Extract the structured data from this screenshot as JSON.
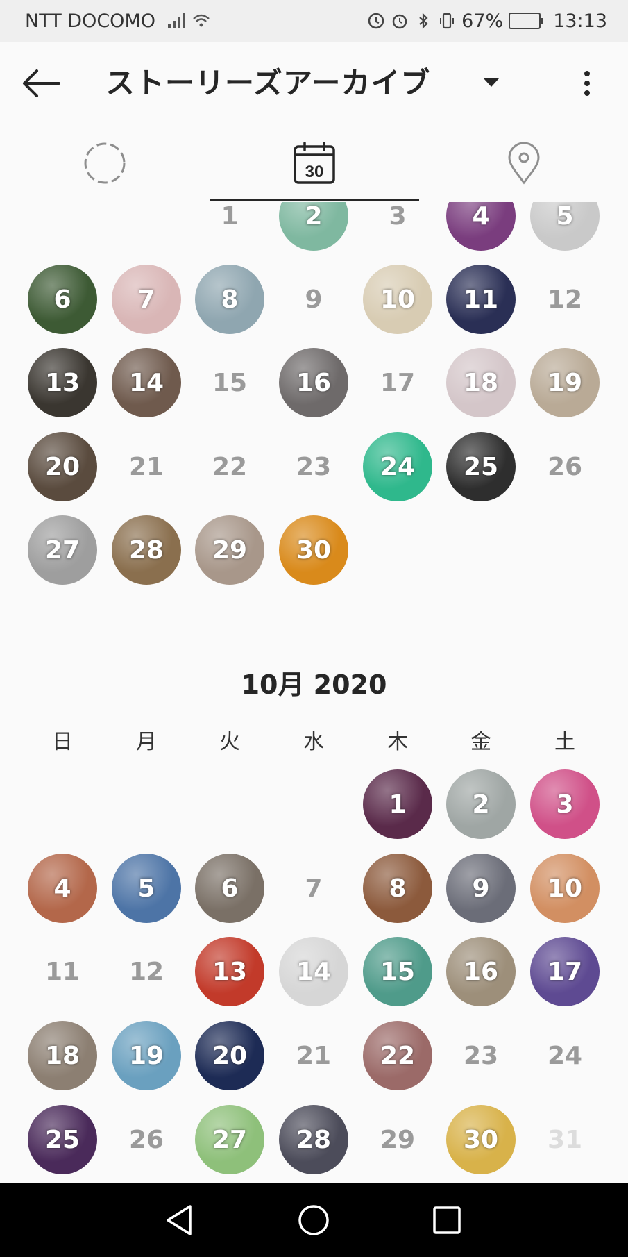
{
  "status_bar": {
    "carrier": "NTT DOCOMO",
    "battery": "67%",
    "battery_level": 0.67,
    "time": "13:13"
  },
  "header": {
    "title": "ストーリーズアーカイブ"
  },
  "tabs": [
    {
      "id": "stories",
      "icon": "dashed-circle-icon",
      "selected": false
    },
    {
      "id": "calendar",
      "icon": "calendar-icon",
      "label": "30",
      "selected": true
    },
    {
      "id": "map",
      "icon": "location-pin-icon",
      "selected": false
    }
  ],
  "weekdays": [
    "日",
    "月",
    "火",
    "水",
    "木",
    "金",
    "土"
  ],
  "september": {
    "first_weekday": 2,
    "days": [
      {
        "d": "1",
        "color": null
      },
      {
        "d": "2",
        "color": "#7fb8a0"
      },
      {
        "d": "3",
        "color": null
      },
      {
        "d": "4",
        "color": "#7a3d7e"
      },
      {
        "d": "5",
        "color": "#c9c9c9"
      },
      {
        "d": "6",
        "color": "#3d5a34"
      },
      {
        "d": "7",
        "color": "#d9b6b6"
      },
      {
        "d": "8",
        "color": "#8fa6b0"
      },
      {
        "d": "9",
        "color": null
      },
      {
        "d": "10",
        "color": "#d8ccb3"
      },
      {
        "d": "11",
        "color": "#2a2f55"
      },
      {
        "d": "12",
        "color": null
      },
      {
        "d": "13",
        "color": "#3a3630"
      },
      {
        "d": "14",
        "color": "#6f5a4d"
      },
      {
        "d": "15",
        "color": null
      },
      {
        "d": "16",
        "color": "#6e6a6a"
      },
      {
        "d": "17",
        "color": null
      },
      {
        "d": "18",
        "color": "#d4c6c9"
      },
      {
        "d": "19",
        "color": "#b9aa96"
      },
      {
        "d": "20",
        "color": "#5a4b3e"
      },
      {
        "d": "21",
        "color": null
      },
      {
        "d": "22",
        "color": null
      },
      {
        "d": "23",
        "color": null
      },
      {
        "d": "24",
        "color": "#2fb88c"
      },
      {
        "d": "25",
        "color": "#2e2e2e"
      },
      {
        "d": "26",
        "color": null
      },
      {
        "d": "27",
        "color": "#9e9e9e"
      },
      {
        "d": "28",
        "color": "#8a6f4e"
      },
      {
        "d": "29",
        "color": "#a8978a"
      },
      {
        "d": "30",
        "color": "#d98a1b"
      }
    ]
  },
  "october": {
    "title": "10月 2020",
    "first_weekday": 4,
    "days": [
      {
        "d": "1",
        "color": "#5a2a4a"
      },
      {
        "d": "2",
        "color": "#9fa6a4"
      },
      {
        "d": "3",
        "color": "#d05088"
      },
      {
        "d": "4",
        "color": "#b3674a"
      },
      {
        "d": "5",
        "color": "#4d74a6"
      },
      {
        "d": "6",
        "color": "#7a7066"
      },
      {
        "d": "7",
        "color": null
      },
      {
        "d": "8",
        "color": "#8c5a3c"
      },
      {
        "d": "9",
        "color": "#6b6d78"
      },
      {
        "d": "10",
        "color": "#d28f62"
      },
      {
        "d": "11",
        "color": null
      },
      {
        "d": "12",
        "color": null
      },
      {
        "d": "13",
        "color": "#c23a2a"
      },
      {
        "d": "14",
        "color": "#d6d6d6"
      },
      {
        "d": "15",
        "color": "#4f9b8a"
      },
      {
        "d": "16",
        "color": "#9d8f7a"
      },
      {
        "d": "17",
        "color": "#5e4a92"
      },
      {
        "d": "18",
        "color": "#8c7f72"
      },
      {
        "d": "19",
        "color": "#6aa0bf"
      },
      {
        "d": "20",
        "color": "#1d2b55"
      },
      {
        "d": "21",
        "color": null
      },
      {
        "d": "22",
        "color": "#9b6a68"
      },
      {
        "d": "23",
        "color": null
      },
      {
        "d": "24",
        "color": null
      },
      {
        "d": "25",
        "color": "#4a2a5a"
      },
      {
        "d": "26",
        "color": null
      },
      {
        "d": "27",
        "color": "#8ec07a"
      },
      {
        "d": "28",
        "color": "#4c4c5a"
      },
      {
        "d": "29",
        "color": null
      },
      {
        "d": "30",
        "color": "#d8b24a"
      },
      {
        "d": "31",
        "color": null,
        "muted": true
      }
    ]
  },
  "nav": [
    {
      "id": "back",
      "icon": "triangle-back-icon"
    },
    {
      "id": "home",
      "icon": "circle-home-icon"
    },
    {
      "id": "recent",
      "icon": "square-recents-icon"
    }
  ]
}
